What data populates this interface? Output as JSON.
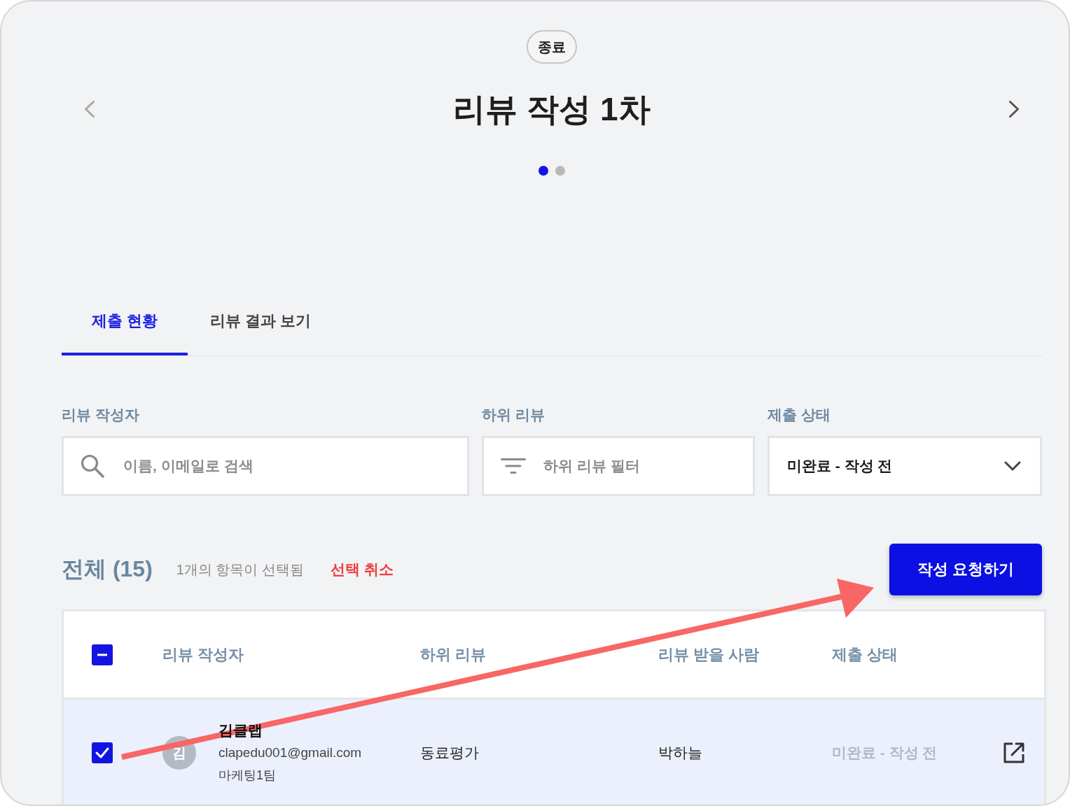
{
  "status_badge": "종료",
  "title": "리뷰 작성 1차",
  "nav": {
    "prev_disabled": true,
    "next_disabled": false
  },
  "pager": [
    {
      "selected": true
    },
    {
      "selected": false
    }
  ],
  "tabs": [
    {
      "label": "제출 현황",
      "selected": true
    },
    {
      "label": "리뷰 결과 보기",
      "selected": false
    }
  ],
  "filters": [
    {
      "kind": "search",
      "label": "리뷰 작성자",
      "placeholder": "이름, 이메일로 검색"
    },
    {
      "kind": "filter",
      "label": "하위 리뷰",
      "placeholder": "하위 리뷰 필터"
    },
    {
      "kind": "select",
      "label": "제출 상태",
      "value": "미완료 - 작성 전"
    }
  ],
  "summary": {
    "total": "전체 (15)",
    "selection": "1개의 항목이 선택됨",
    "clear": "선택 취소"
  },
  "request_button": "작성 요청하기",
  "table": {
    "select_all": {
      "checked": true,
      "partial": true
    },
    "columns": [
      "리뷰 작성자",
      "하위 리뷰",
      "리뷰 받을 사람",
      "제출 상태"
    ],
    "rows": [
      {
        "selected": true,
        "avatar": "김",
        "name": "김클랩",
        "email": "clapedu001@gmail.com",
        "team": "마케팅1팀",
        "sub_review": "동료평가",
        "reviewee": "박하늘",
        "status": "미완료 - 작성 전"
      }
    ]
  }
}
